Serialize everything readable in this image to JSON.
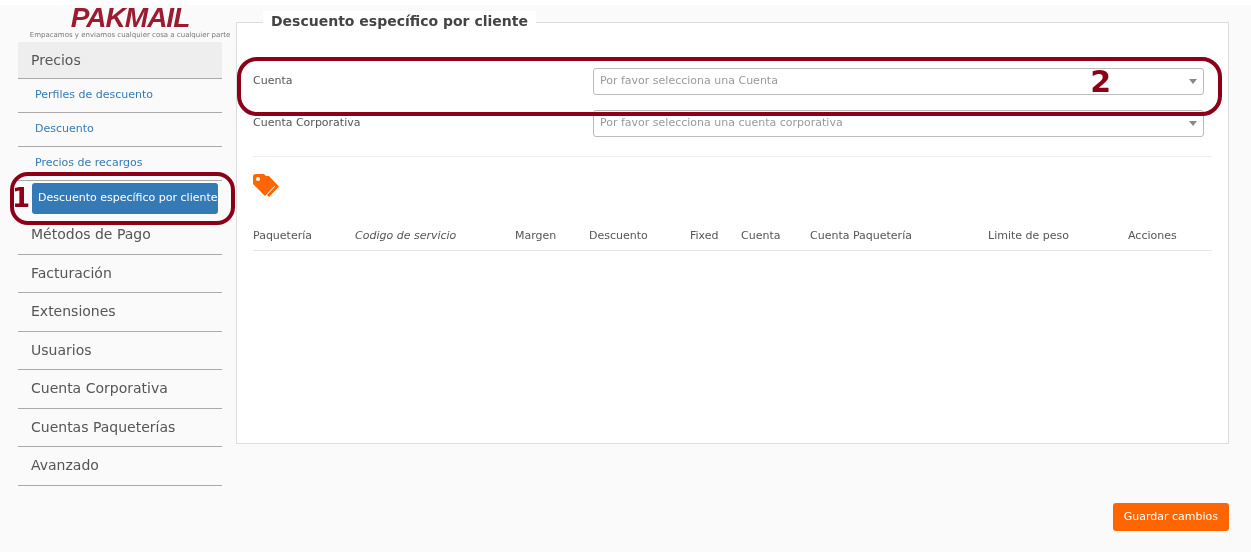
{
  "logo": {
    "brand": "PAKMAIL",
    "tagline": "Empacamos y enviamos cualquier cosa a cualquier parte"
  },
  "sidebar": {
    "items": [
      {
        "label": "Precios",
        "kind": "header",
        "selected": false
      },
      {
        "label": "Perfiles de descuento",
        "kind": "sub",
        "selected": false
      },
      {
        "label": "Descuento",
        "kind": "sub",
        "selected": false
      },
      {
        "label": "Precios de recargos",
        "kind": "sub",
        "selected": false
      },
      {
        "label": "Descuento específico por cliente",
        "kind": "sub",
        "selected": true
      },
      {
        "label": "Métodos de Pago",
        "kind": "main",
        "selected": false
      },
      {
        "label": "Facturación",
        "kind": "main",
        "selected": false
      },
      {
        "label": "Extensiones",
        "kind": "main",
        "selected": false
      },
      {
        "label": "Usuarios",
        "kind": "main",
        "selected": false
      },
      {
        "label": "Cuenta Corporativa",
        "kind": "main",
        "selected": false
      },
      {
        "label": "Cuentas Paqueterías",
        "kind": "main",
        "selected": false
      },
      {
        "label": "Avanzado",
        "kind": "main",
        "selected": false
      }
    ]
  },
  "panel": {
    "title": "Descuento específico por cliente",
    "fields": [
      {
        "label": "Cuenta",
        "placeholder": "Por favor selecciona una Cuenta"
      },
      {
        "label": "Cuenta Corporativa",
        "placeholder": "Por favor selecciona una cuenta corporativa"
      }
    ],
    "table": {
      "columns": [
        {
          "label": "Paquetería",
          "italic": false
        },
        {
          "label": "Codigo de servicio",
          "italic": true
        },
        {
          "label": "Margen",
          "italic": false
        },
        {
          "label": "Descuento",
          "italic": false
        },
        {
          "label": "Fixed",
          "italic": false
        },
        {
          "label": "Cuenta",
          "italic": false
        },
        {
          "label": "Cuenta Paquetería",
          "italic": false
        },
        {
          "label": "Limite de peso",
          "italic": false
        },
        {
          "label": "Acciones",
          "italic": false
        }
      ]
    }
  },
  "save_button": "Guardar cambios",
  "callouts": [
    {
      "label": "1"
    },
    {
      "label": "2"
    }
  ]
}
